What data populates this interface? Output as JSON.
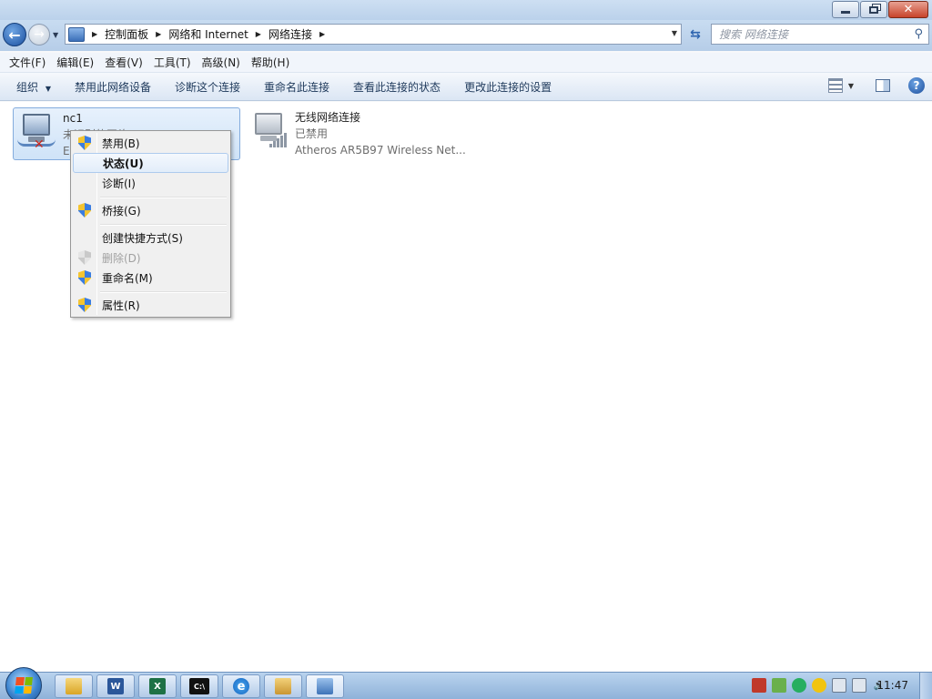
{
  "window": {
    "controls": {
      "minimize": "—",
      "maximize": "❐",
      "close": "✕"
    }
  },
  "address": {
    "crumbs": [
      "控制面板",
      "网络和 Internet",
      "网络连接"
    ],
    "search_placeholder": "搜索 网络连接"
  },
  "menubar": {
    "items": [
      "文件(F)",
      "编辑(E)",
      "查看(V)",
      "工具(T)",
      "高级(N)",
      "帮助(H)"
    ]
  },
  "commandbar": {
    "organize": "组织",
    "items": [
      "禁用此网络设备",
      "诊断这个连接",
      "重命名此连接",
      "查看此连接的状态",
      "更改此连接的设置"
    ],
    "help": "?"
  },
  "connections": [
    {
      "name": "nc1",
      "status": "未识别的网络",
      "device": "E"
    },
    {
      "name": "无线网络连接",
      "status": "已禁用",
      "device": "Atheros AR5B97 Wireless Net..."
    }
  ],
  "context_menu": {
    "items": [
      {
        "label": "禁用(B)",
        "icon": "uac-shield-icon",
        "state": "normal"
      },
      {
        "label": "状态(U)",
        "icon": "",
        "state": "default-hover"
      },
      {
        "label": "诊断(I)",
        "icon": "",
        "state": "normal"
      },
      {
        "label": "桥接(G)",
        "icon": "uac-shield-icon",
        "state": "normal"
      },
      {
        "label": "创建快捷方式(S)",
        "icon": "",
        "state": "normal"
      },
      {
        "label": "删除(D)",
        "icon": "uac-shield-icon",
        "state": "disabled"
      },
      {
        "label": "重命名(M)",
        "icon": "uac-shield-icon",
        "state": "normal"
      },
      {
        "label": "属性(R)",
        "icon": "uac-shield-icon",
        "state": "normal"
      }
    ]
  },
  "taskbar": {
    "clock": "11:47",
    "pinned": [
      "explorer-icon",
      "word-icon",
      "excel-icon",
      "cmd-icon",
      "ie-icon",
      "package-icon",
      "network-connections-icon"
    ],
    "cmd_glyph": "C:\\",
    "word_glyph": "W",
    "excel_glyph": "X",
    "ie_glyph": "e"
  },
  "colors": {
    "selection": "#cfe3f8",
    "accent": "#1c4e9c",
    "disabled_text": "#a0a0a0"
  }
}
